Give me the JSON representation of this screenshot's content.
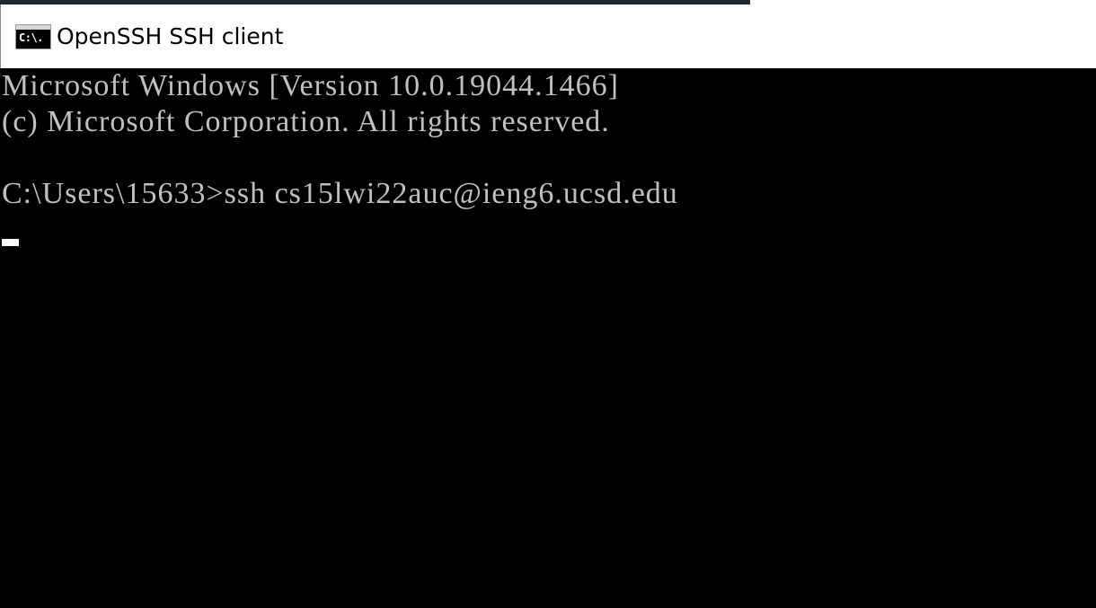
{
  "window": {
    "title": "OpenSSH SSH client",
    "icon": "console-icon",
    "icon_glyph": "C:\\."
  },
  "console": {
    "lines": [
      "Microsoft Windows [Version 10.0.19044.1466]",
      "(c) Microsoft Corporation. All rights reserved.",
      "",
      "C:\\Users\\15633>ssh cs15lwi22auc@ieng6.ucsd.edu"
    ],
    "cursor": "block-cursor"
  },
  "colors": {
    "background": "#000000",
    "text": "#c0c0c0",
    "titlebar": "#ffffff"
  }
}
